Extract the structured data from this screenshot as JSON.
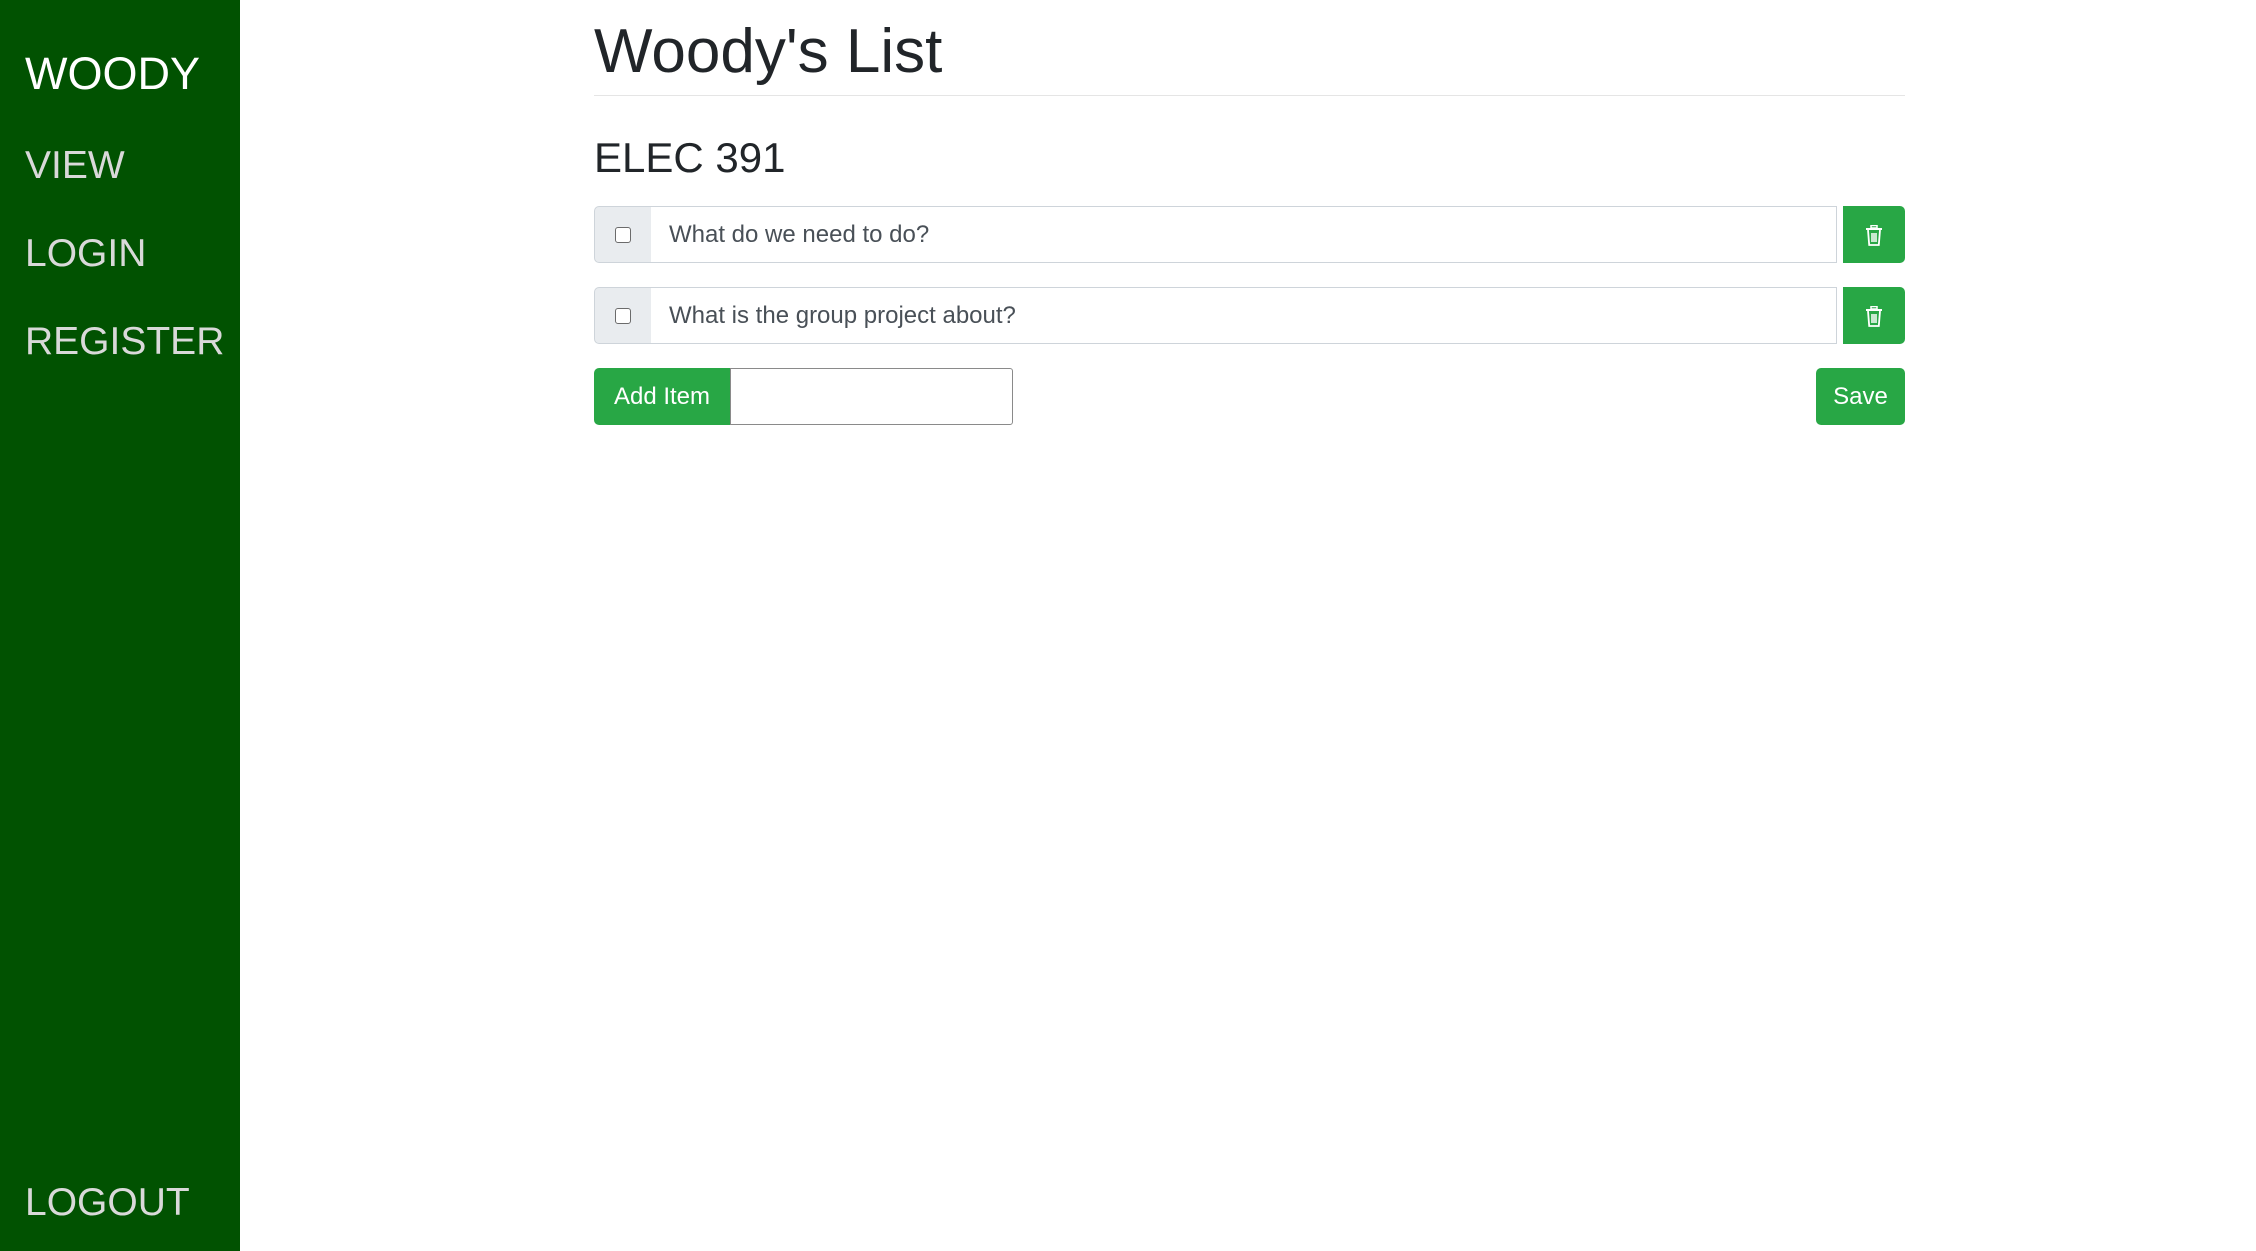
{
  "sidebar": {
    "brand": "WOODY",
    "nav": {
      "view": "VIEW",
      "login": "LOGIN",
      "register": "REGISTER",
      "logout": "LOGOUT"
    },
    "background_color": "#015201"
  },
  "main": {
    "page_title": "Woody's List",
    "list_title": "ELEC 391",
    "items": [
      {
        "text": "What do we need to do?",
        "checked": false
      },
      {
        "text": "What is the group project about?",
        "checked": false
      }
    ],
    "add_button_label": "Add Item",
    "add_input_value": "",
    "save_button_label": "Save",
    "accent_color": "#28a745",
    "delete_icon": "trash-icon"
  }
}
